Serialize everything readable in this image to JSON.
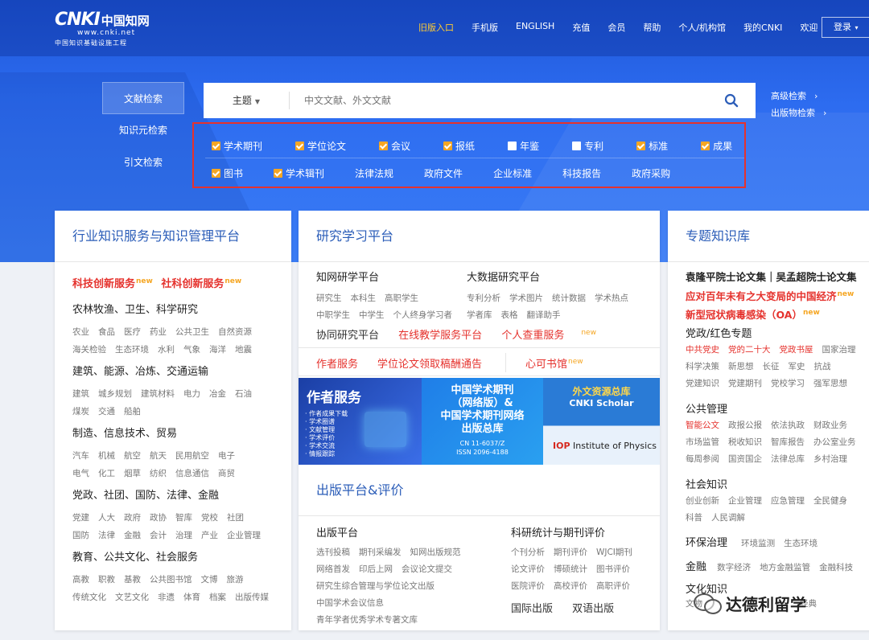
{
  "header": {
    "logo_mark": "CNKI",
    "logo_cn": "中国知网",
    "logo_url": "www.cnki.net",
    "logo_sub": "中国知识基础设施工程",
    "nav": [
      "旧版入口",
      "手机版",
      "ENGLISH",
      "充值",
      "会员",
      "帮助",
      "个人/机构馆",
      "我的CNKI",
      "欢迎"
    ],
    "login": "登录",
    "accent": "#ffcc33"
  },
  "search": {
    "tabs": [
      "文献检索",
      "知识元检索",
      "引文检索"
    ],
    "field": "主题",
    "placeholder": "中文文献、外文文献",
    "advanced": "高级检索",
    "publication": "出版物检索"
  },
  "databases": {
    "row1": [
      {
        "label": "学术期刊",
        "checked": true
      },
      {
        "label": "学位论文",
        "checked": true
      },
      {
        "label": "会议",
        "checked": true
      },
      {
        "label": "报纸",
        "checked": true
      },
      {
        "label": "年鉴",
        "checked": false
      },
      {
        "label": "专利",
        "checked": false
      },
      {
        "label": "标准",
        "checked": true
      },
      {
        "label": "成果",
        "checked": true
      }
    ],
    "row2": [
      {
        "label": "图书",
        "checked": true
      },
      {
        "label": "学术辑刊",
        "checked": true
      },
      {
        "label": "法律法规",
        "checked": null
      },
      {
        "label": "政府文件",
        "checked": null
      },
      {
        "label": "企业标准",
        "checked": null
      },
      {
        "label": "科技报告",
        "checked": null
      },
      {
        "label": "政府采购",
        "checked": null
      }
    ]
  },
  "industry": {
    "title": "行业知识服务与知识管理平台",
    "highlight1": "科技创新服务",
    "highlight2": "社科创新服务",
    "new_badge": "new",
    "groups": [
      {
        "title": "农林牧渔、卫生、科学研究",
        "rows": [
          [
            "农业",
            "食品",
            "医疗",
            "药业",
            "公共卫生",
            "自然资源"
          ],
          [
            "海关检验",
            "生态环境",
            "水利",
            "气象",
            "海洋",
            "地震"
          ]
        ]
      },
      {
        "title": "建筑、能源、冶炼、交通运输",
        "rows": [
          [
            "建筑",
            "城乡规划",
            "建筑材料",
            "电力",
            "冶金",
            "石油"
          ],
          [
            "煤炭",
            "交通",
            "船舶"
          ]
        ]
      },
      {
        "title": "制造、信息技术、贸易",
        "rows": [
          [
            "汽车",
            "机械",
            "航空",
            "航天",
            "民用航空",
            "电子"
          ],
          [
            "电气",
            "化工",
            "烟草",
            "纺织",
            "信息通信",
            "商贸"
          ]
        ]
      },
      {
        "title": "党政、社团、国防、法律、金融",
        "rows": [
          [
            "党建",
            "人大",
            "政府",
            "政协",
            "智库",
            "党校",
            "社团"
          ],
          [
            "国防",
            "法律",
            "金融",
            "会计",
            "治理",
            "产业",
            "企业管理"
          ]
        ]
      },
      {
        "title": "教育、公共文化、社会服务",
        "rows": [
          [
            "高教",
            "职教",
            "基教",
            "公共图书馆",
            "文博",
            "旅游"
          ],
          [
            "传统文化",
            "文艺文化",
            "非遗",
            "体育",
            "档案",
            "出版传媒"
          ]
        ]
      }
    ]
  },
  "research": {
    "title": "研究学习平台",
    "zhiwang_title": "知网研学平台",
    "zhiwang_rows": [
      [
        "研究生",
        "本科生",
        "高职学生"
      ],
      [
        "中职学生",
        "中学生",
        "个人终身学习者"
      ]
    ],
    "bigdata_title": "大数据研究平台",
    "bigdata_rows": [
      [
        "专利分析",
        "学术图片",
        "统计数据",
        "学术热点"
      ],
      [
        "学者库",
        "表格",
        "翻译助手"
      ]
    ],
    "links": [
      "协同研究平台",
      "在线教学服务平台",
      "个人查重服务"
    ],
    "services": [
      "作者服务",
      "学位论文领取稿酬通告",
      "心可书馆"
    ],
    "banner1_title": "作者服务",
    "banner1_items": [
      "作者成果下载",
      "学术圈谱",
      "文献管理",
      "学术评价",
      "学术交流",
      "情报跟踪"
    ],
    "banner2_lines": [
      "中国学术期刊",
      "（网络版）&",
      "中国学术期刊网络",
      "出版总库"
    ],
    "banner2_small": [
      "CN 11-6037/Z",
      "ISSN 2096-4188"
    ],
    "banner3_t1": "外文资源总库",
    "banner3_t2": "CNKI Scholar",
    "banner3_iop_bold": "IOP",
    "banner3_iop_rest": "Institute of Physics",
    "pub_title": "出版平台&评价",
    "pub_left_title": "出版平台",
    "pub_left_rows": [
      [
        "选刊投稿",
        "期刊采编发",
        "知网出版规范"
      ],
      [
        "网络首发",
        "印后上网",
        "会议论文提交"
      ],
      [
        "研究生综合管理与学位论文出版"
      ],
      [
        "中国学术会议信息"
      ],
      [
        "青年学者优秀学术专著文库"
      ]
    ],
    "pub_right_title": "科研统计与期刊评价",
    "pub_right_rows": [
      [
        "个刊分析",
        "期刊评价",
        "WJCI期刊"
      ],
      [
        "论文评价",
        "博硕统计",
        "图书评价"
      ],
      [
        "医院评价",
        "高校评价",
        "高职评价"
      ]
    ],
    "pub_extra": [
      "国际出版",
      "双语出版"
    ]
  },
  "topics": {
    "title": "专题知识库",
    "item1": "袁隆平院士论文集｜吴孟超院士论文集",
    "item2": "应对百年未有之大变局的中国经济",
    "item3": "新型冠状病毒感染（OA）",
    "groups": [
      {
        "title": "党政/红色专题",
        "rows": [
          [
            "中共党史",
            "党的二十大",
            "党政书屋",
            "国家治理"
          ],
          [
            "科学决策",
            "新思想",
            "长征",
            "军史",
            "抗战"
          ],
          [
            "党建知识",
            "党建期刊",
            "党校学习",
            "强军思想"
          ]
        ],
        "red": [
          "中共党史",
          "党的二十大",
          "党政书屋"
        ]
      },
      {
        "title": "公共管理",
        "rows": [
          [
            "智能公文",
            "政报公报",
            "依法执政",
            "财政业务"
          ],
          [
            "市场监管",
            "税收知识",
            "智库报告",
            "办公室业务"
          ],
          [
            "每周参阅",
            "国资国企",
            "法律总库",
            "乡村治理"
          ]
        ],
        "red": [
          "智能公文"
        ]
      },
      {
        "title": "社会知识",
        "rows": [
          [
            "创业创新",
            "企业管理",
            "应急管理",
            "全民健身"
          ],
          [
            "科普",
            "人民调解"
          ]
        ],
        "red": []
      }
    ],
    "env_title": "环保治理",
    "env_items": [
      "环境监测",
      "生态环境"
    ],
    "fin_title": "金融",
    "fin_items": [
      "数字经济",
      "地方金融监管",
      "金融科技"
    ],
    "culture_title": "文化知识",
    "culture_items": [
      "文物",
      "经典"
    ]
  },
  "watermark": "达德利留学"
}
